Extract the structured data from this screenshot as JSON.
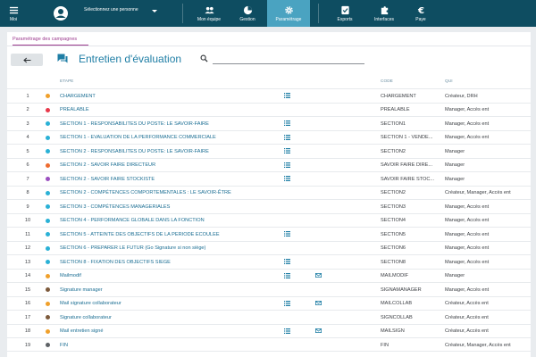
{
  "topbar": {
    "moi": "Moi",
    "select_person": "Sélectionnez une personne",
    "items": [
      {
        "label": "Mon équipe",
        "icon": "team-icon"
      },
      {
        "label": "Gestion",
        "icon": "pie-chart-icon"
      },
      {
        "label": "Paramétrage",
        "icon": "gear-icon",
        "active": true
      },
      {
        "label": "Exports",
        "icon": "export-icon"
      },
      {
        "label": "Interfaces",
        "icon": "puzzle-icon"
      },
      {
        "label": "Paye",
        "icon": "euro-icon"
      }
    ],
    "colors": {
      "bar": "#0e4d61",
      "active": "#4aa3c1"
    }
  },
  "breadcrumb": "Paramétrage des campagnes",
  "page_title": "Entretien d'évaluation",
  "search": {
    "placeholder": "",
    "value": ""
  },
  "table": {
    "headers": {
      "etape": "ETAPE",
      "code": "CODE",
      "qui": "QUI"
    },
    "rows": [
      {
        "num": "1",
        "color": "#f0a02b",
        "step": "CHARGEMENT",
        "list": true,
        "mail": false,
        "code": "CHARGEMENT",
        "qui": "Créateur, DRH"
      },
      {
        "num": "2",
        "color": "#e8394b",
        "step": "PREALABLE",
        "list": false,
        "mail": false,
        "code": "PREALABLE",
        "qui": "Manager, Accès ent"
      },
      {
        "num": "3",
        "color": "#2ab1d6",
        "step": "SECTION 1 - RESPONSABILITES DU POSTE: LE SAVOIR-FAIRE",
        "list": true,
        "mail": false,
        "code": "SECTION1",
        "qui": "Manager, Accès ent"
      },
      {
        "num": "4",
        "color": "#2ab1d6",
        "step": "SECTION 1 - EVALUATION DE LA PERFORMANCE COMMERCIALE",
        "list": true,
        "mail": false,
        "code": "SECTION 1 - VENDE...",
        "qui": "Manager, Accès ent"
      },
      {
        "num": "5",
        "color": "#2ab1d6",
        "step": "SECTION 2 - RESPONSABILITES DU POSTE: LE SAVOIR-FAIRE",
        "list": true,
        "mail": false,
        "code": "SECTION2",
        "qui": "Manager"
      },
      {
        "num": "6",
        "color": "#ee6b2f",
        "step": "SECTION 2 - SAVOIR FAIRE DIRECTEUR",
        "list": true,
        "mail": false,
        "code": "SAVOIR FAIRE DIRE...",
        "qui": "Manager"
      },
      {
        "num": "7",
        "color": "#9b4fc0",
        "step": "SECTION 2 - SAVOIR FAIRE STOCKISTE",
        "list": true,
        "mail": false,
        "code": "SAVOIR FAIRE STOC...",
        "qui": "Manager"
      },
      {
        "num": "8",
        "color": "#2ab1d6",
        "step": "SECTION 2 - COMPÉTENCES COMPORTEMENTALES : LE SAVOIR-ÊTRE",
        "list": false,
        "mail": false,
        "code": "SECTION2",
        "qui": "Créateur, Manager, Accès ent"
      },
      {
        "num": "9",
        "color": "#2ab1d6",
        "step": "SECTION 3 - COMPÉTENCES MANAGERIALES",
        "list": false,
        "mail": false,
        "code": "SECTION3",
        "qui": "Manager, Accès ent"
      },
      {
        "num": "10",
        "color": "#2ab1d6",
        "step": "SECTION 4 - PERFORMANCE GLOBALE DANS LA FONCTION",
        "list": false,
        "mail": false,
        "code": "SECTION4",
        "qui": "Manager, Accès ent"
      },
      {
        "num": "11",
        "color": "#2ab1d6",
        "step": "SECTION 5 - ATTEINTE DES OBJECTIFS DE LA PERIODE ECOULEE",
        "list": true,
        "mail": false,
        "code": "SECTION5",
        "qui": "Manager, Accès ent"
      },
      {
        "num": "12",
        "color": "#2ab1d6",
        "step": "SECTION 6 - PREPARER LE FUTUR (Go Signature si non siège)",
        "list": false,
        "mail": false,
        "code": "SECTION6",
        "qui": "Manager, Accès ent"
      },
      {
        "num": "13",
        "color": "#2ab1d6",
        "step": "SECTION 8 - FIXATION DES OBJECTIFS SIEGE",
        "list": true,
        "mail": false,
        "code": "SECTION8",
        "qui": "Manager, Accès ent"
      },
      {
        "num": "14",
        "color": "#f0a02b",
        "step": "Mailmodif",
        "list": true,
        "mail": true,
        "code": "MAILMODIF",
        "qui": "Manager"
      },
      {
        "num": "15",
        "color": "#7d5a3c",
        "step": "Signature manager",
        "list": false,
        "mail": false,
        "code": "SIGNAMANAGER",
        "qui": "Manager, Accès ent"
      },
      {
        "num": "16",
        "color": "#f0a02b",
        "step": "Mail signature collaborateur",
        "list": true,
        "mail": true,
        "code": "MAILCOLLAB",
        "qui": "Créateur, Accès ent"
      },
      {
        "num": "17",
        "color": "#7d5a3c",
        "step": "Signature collaborateur",
        "list": false,
        "mail": false,
        "code": "SIGNCOLLAB",
        "qui": "Créateur, Accès ent"
      },
      {
        "num": "18",
        "color": "#f0a02b",
        "step": "Mail entretien signé",
        "list": true,
        "mail": true,
        "code": "MAILSIGN",
        "qui": "Créateur, Accès ent"
      },
      {
        "num": "19",
        "color": "#5e6266",
        "step": "FIN",
        "list": false,
        "mail": false,
        "code": "FIN",
        "qui": "Créateur, Manager, Accès ent"
      }
    ]
  }
}
